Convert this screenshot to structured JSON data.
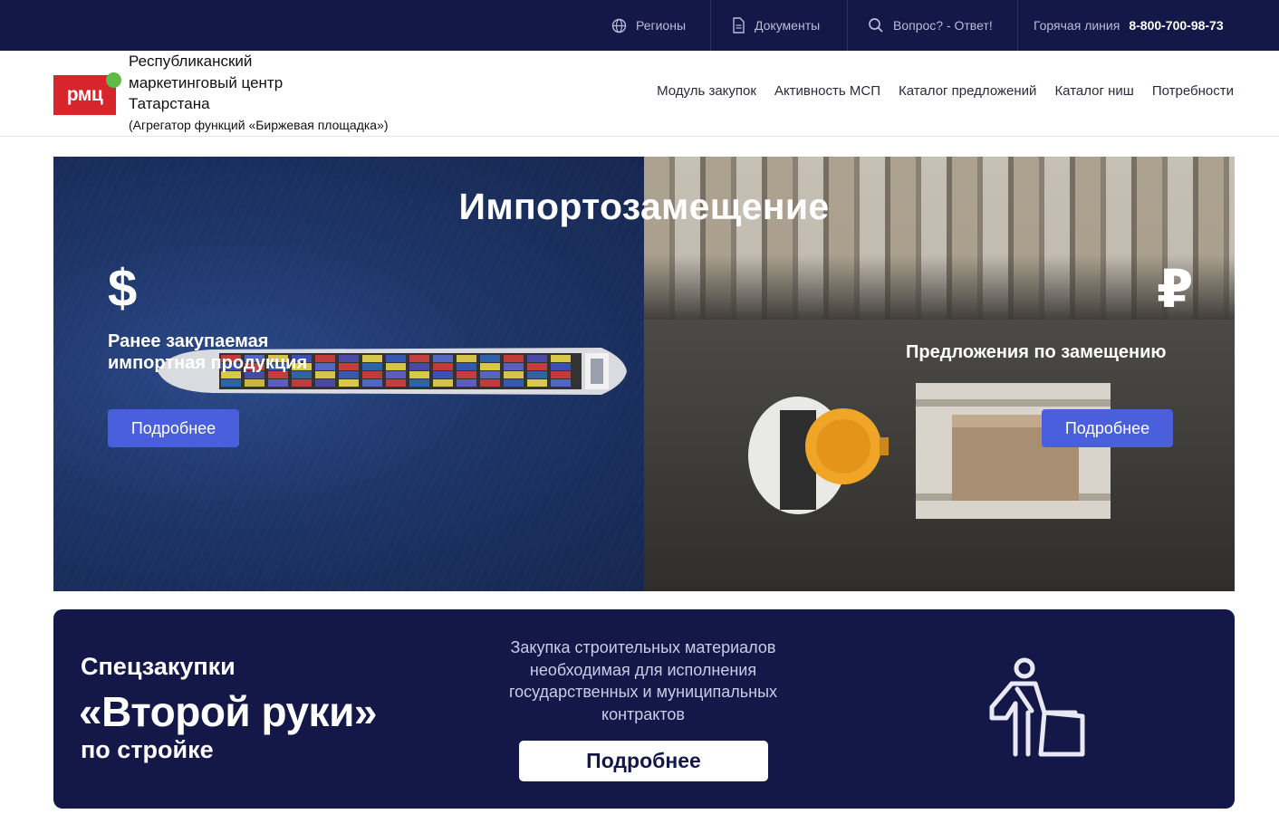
{
  "topbar": {
    "regions": "Регионы",
    "documents": "Документы",
    "faq": "Вопрос? - Ответ!",
    "hotline_label": "Горячая линия",
    "hotline_phone": "8-800-700-98-73"
  },
  "header": {
    "logo_text": "рмц",
    "org_line1": "Республиканский",
    "org_line2": "маркетинговый центр",
    "org_line3": "Татарстана",
    "org_line4": "(Агрегатор функций «Биржевая площадка»)",
    "nav": [
      "Модуль закупок",
      "Активность МСП",
      "Каталог предложений",
      "Каталог ниш",
      "Потребности"
    ]
  },
  "hero": {
    "title": "Импортозамещение",
    "left_symbol": "$",
    "left_line1": "Ранее закупаемая",
    "left_line2": "импортная продукция",
    "left_button": "Подробнее",
    "right_symbol": "₽",
    "right_text": "Предложения по замещению",
    "right_button": "Подробнее"
  },
  "banner": {
    "line1": "Спецзакупки",
    "line2": "«Второй руки»",
    "line3": "по стройке",
    "description": "Закупка строительных материалов необходимая для исполнения государственных и муниципальных контрактов",
    "button": "Подробнее",
    "icon": "construction-worker-icon"
  },
  "colors": {
    "navy": "#141849",
    "accent_blue": "#4a5fdb",
    "logo_red": "#d7262b",
    "logo_green": "#5dbb46"
  }
}
